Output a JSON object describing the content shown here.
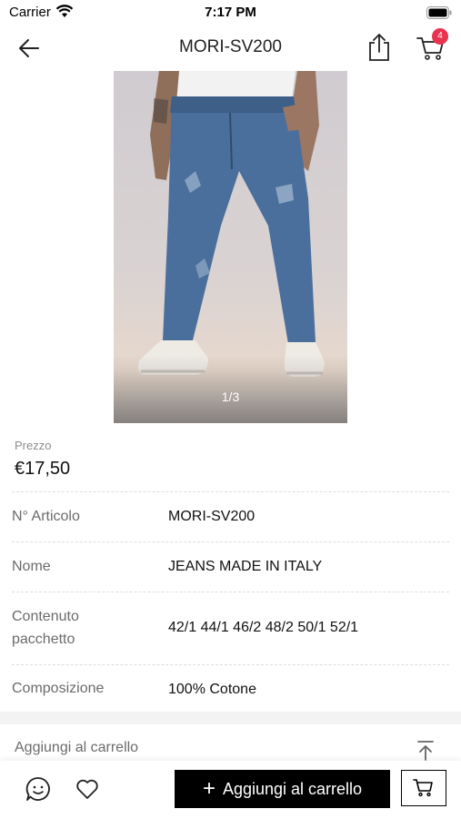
{
  "status_bar": {
    "carrier": "Carrier",
    "time": "7:17 PM"
  },
  "nav": {
    "title": "MORI-SV200",
    "cart_badge": "4"
  },
  "gallery": {
    "counter": "1/3"
  },
  "price": {
    "label": "Prezzo",
    "value": "€17,50"
  },
  "details": [
    {
      "label": "N° Articolo",
      "value": "MORI-SV200"
    },
    {
      "label": "Nome",
      "value": "JEANS MADE IN ITALY"
    },
    {
      "label_line1": "Contenuto",
      "label_line2": "pacchetto",
      "value": "42/1 44/1 46/2 48/2 50/1 52/1"
    },
    {
      "label": "Composizione",
      "value": "100% Cotone"
    }
  ],
  "add_section": {
    "label": "Aggiungi al carrello"
  },
  "bottom_bar": {
    "add_button": "Aggiungi al carrello"
  },
  "colors": {
    "badge": "#e8334f",
    "primary_button": "#000000",
    "jeans": "#4a6f9c"
  }
}
